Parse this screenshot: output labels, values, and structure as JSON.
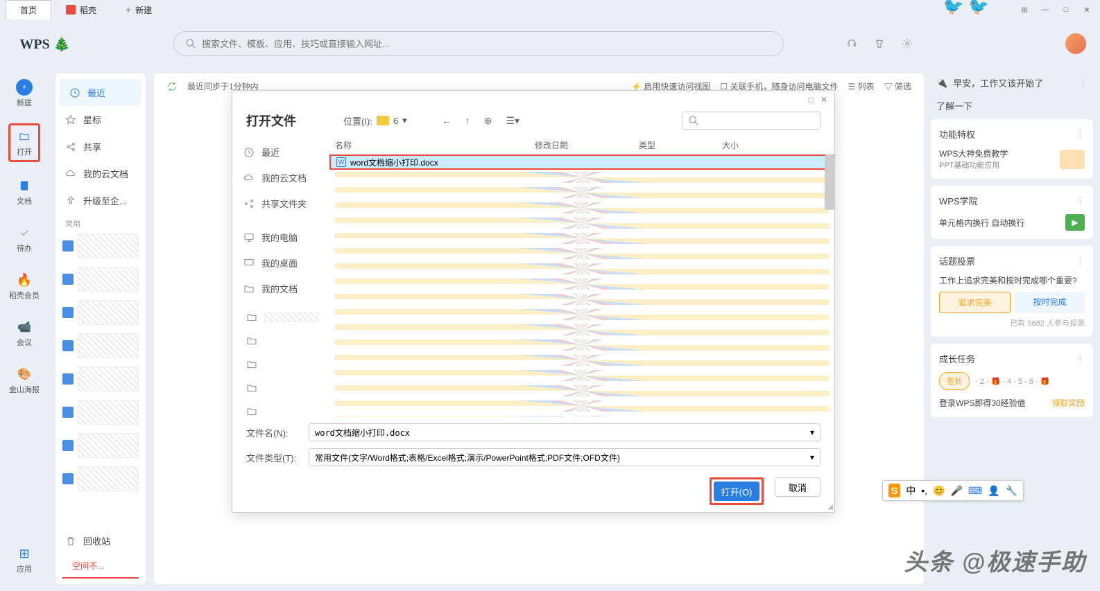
{
  "tabs": {
    "home": "首页",
    "docker": "稻壳",
    "new": "新建"
  },
  "win": {
    "layout": "⊞",
    "min": "—",
    "max": "□",
    "close": "✕"
  },
  "search": {
    "placeholder": "搜索文件、模板、应用、技巧或直接输入网址..."
  },
  "sidebar": {
    "new": "新建",
    "open": "打开",
    "docs": "文档",
    "todo": "待办",
    "member": "稻壳会员",
    "meeting": "会议",
    "poster": "金山海报",
    "apps": "应用"
  },
  "nav": {
    "recent": "最近",
    "star": "星标",
    "share": "共享",
    "cloud": "我的云文档",
    "upgrade": "升级至企...",
    "common": "常用",
    "recycle": "回收站",
    "storage": "空间不..."
  },
  "main": {
    "sync": "最近同步于1分钟内",
    "quick": "启用快速访问视图",
    "link_phone": "关联手机，随身访问电脑文件",
    "list": "列表",
    "filter": "筛选"
  },
  "right": {
    "greeting": "早安，工作又该开始了",
    "learn": "了解一下",
    "feat_title": "功能特权",
    "feat_item": "WPS大神免费教学",
    "feat_sub": "PPT基础功能应用",
    "college_title": "WPS学院",
    "college_item": "单元格内换行 自动换行",
    "vote_title": "话题投票",
    "vote_q": "工作上追求完美和按时完成哪个重要?",
    "vote_a": "追求完美",
    "vote_b": "按时完成",
    "vote_count_prefix": "已有 ",
    "vote_count": "5682",
    "vote_count_suffix": " 人参与投票",
    "task_title": "成长任务",
    "task_signin": "签到",
    "task_login": "登录WPS即得30经验值",
    "task_claim": "领取奖励"
  },
  "dialog": {
    "title": "打开文件",
    "location_label": "位置(I):",
    "location_value": "6",
    "side": {
      "recent": "最近",
      "cloud": "我的云文档",
      "share": "共享文件夹",
      "computer": "我的电脑",
      "desktop": "我的桌面",
      "mydocs": "我的文档",
      "folder6": "6"
    },
    "cols": {
      "name": "名称",
      "date": "修改日期",
      "type": "类型",
      "size": "大小"
    },
    "selected_file": "word文档缩小打印.docx",
    "filename_label": "文件名(N):",
    "filename_value": "word文档缩小打印.docx",
    "filetype_label": "文件类型(T):",
    "filetype_value": "常用文件(文字/Word格式;表格/Excel格式;演示/PowerPoint格式;PDF文件;OFD文件)",
    "open_btn": "打开(O)",
    "cancel_btn": "取消"
  },
  "ime": {
    "zh": "中",
    "dot": "•,"
  },
  "watermark": "头条 @极速手助"
}
